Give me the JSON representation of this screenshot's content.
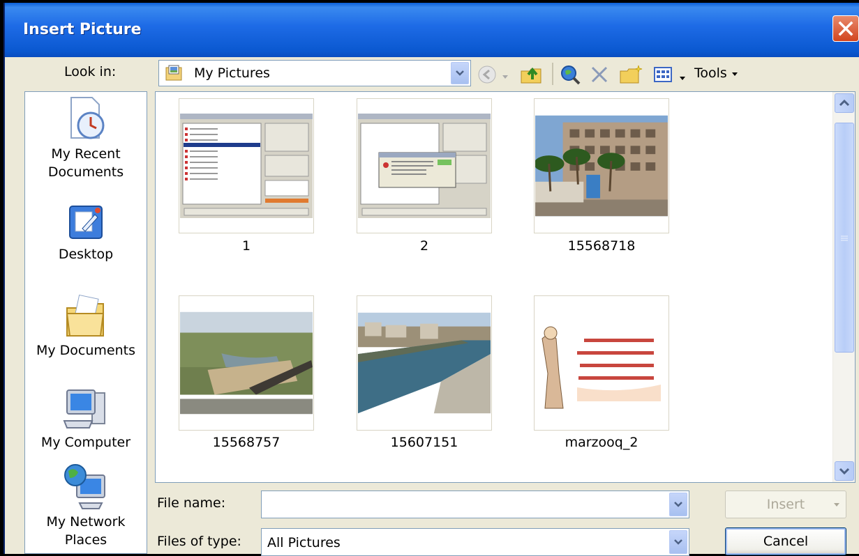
{
  "window": {
    "title": "Insert Picture"
  },
  "lookin": {
    "label": "Look in:",
    "value": "My Pictures"
  },
  "toolbar": {
    "tools_label": "Tools"
  },
  "places": [
    {
      "label": "My Recent Documents"
    },
    {
      "label": "Desktop"
    },
    {
      "label": "My Documents"
    },
    {
      "label": "My Computer"
    },
    {
      "label": "My Network Places"
    }
  ],
  "files": [
    {
      "name": "1"
    },
    {
      "name": "2"
    },
    {
      "name": "15568718"
    },
    {
      "name": "15568757"
    },
    {
      "name": "15607151"
    },
    {
      "name": "marzooq_2"
    }
  ],
  "filename": {
    "label": "File name:",
    "value": ""
  },
  "filetype": {
    "label": "Files of type:",
    "value": "All Pictures"
  },
  "buttons": {
    "insert": "Insert",
    "cancel": "Cancel"
  },
  "colors": {
    "titlebar": "#0A58D0",
    "dialog_bg": "#ECE9D8",
    "accent": "#316AC5"
  }
}
